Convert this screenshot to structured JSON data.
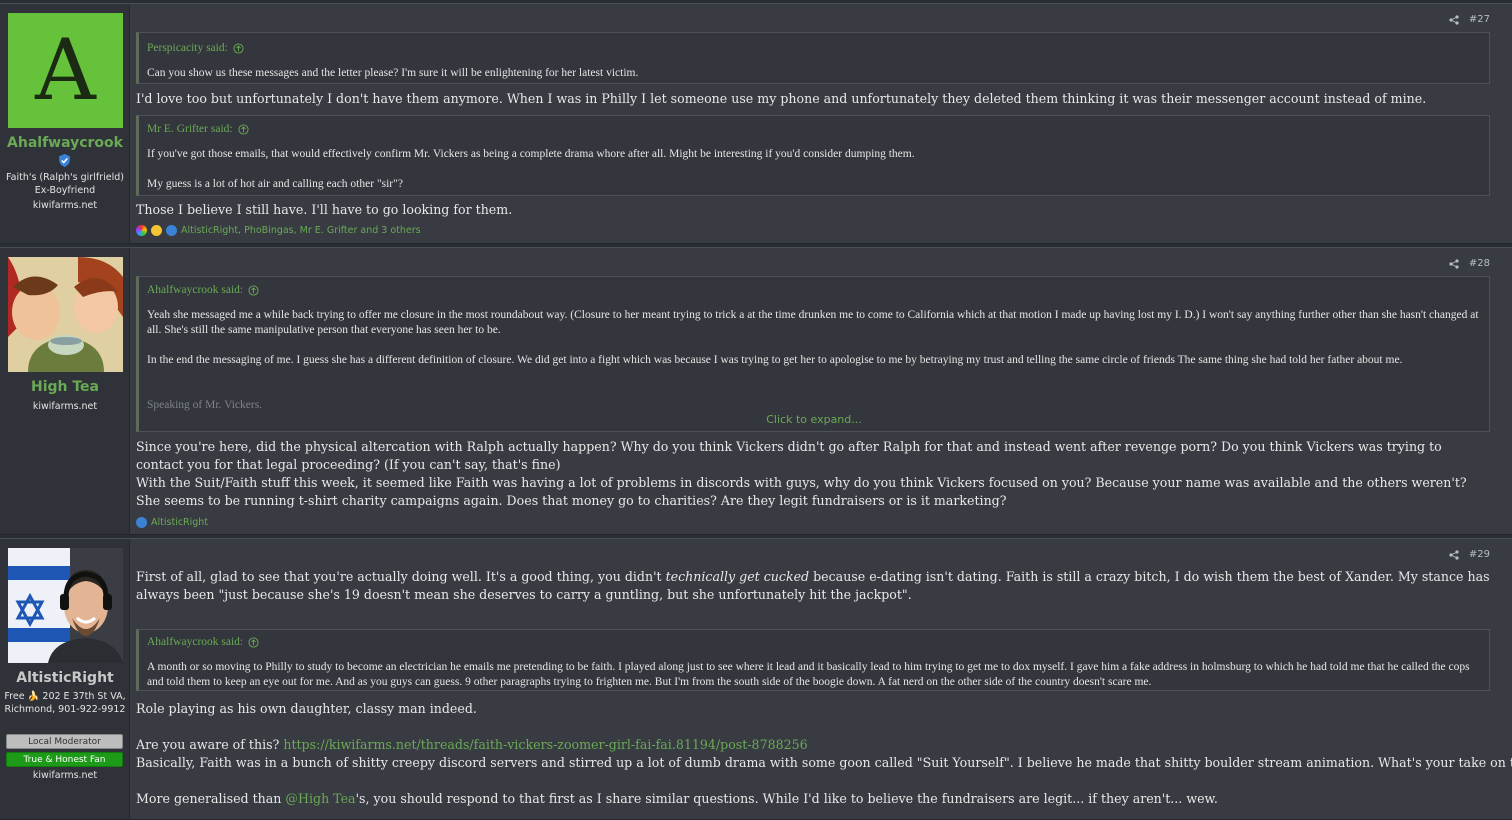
{
  "colors": {
    "accent": "#6aaa55",
    "post_bg": "#383b42",
    "quote_bg": "#33363c"
  },
  "posts": [
    {
      "number": "#27",
      "user": {
        "avatar_letter": "A",
        "name": "Ahalfwaycrook",
        "title": "Faith's (Ralph's girlfrield) Ex-Boyfriend",
        "site": "kiwifarms.net"
      },
      "quote1": {
        "author": "Perspicacity said:",
        "body": "Can you show us these messages and the letter please? I'm sure it will be enlightening for her latest victim."
      },
      "text1": "I'd love too but unfortunately I don't have them anymore. When I was in Philly I let someone use my phone and unfortunately they deleted them thinking it was their messenger account instead of mine.",
      "quote2": {
        "author": "Mr E. Grifter said:",
        "line1": "If you've got those emails, that would effectively confirm Mr. Vickers as being a complete drama whore after all. Might be interesting if you'd consider dumping them.",
        "line2": "My guess is a lot of hot air and calling each other \"sir\"?"
      },
      "text2": "Those I believe I still have. I'll have to go looking for them.",
      "reactions": "AltisticRight, PhoBingas, Mr E. Grifter and 3 others"
    },
    {
      "number": "#28",
      "user": {
        "name": "High Tea",
        "site": "kiwifarms.net"
      },
      "quote1": {
        "author": "Ahalfwaycrook said:",
        "para1": "Yeah she messaged me a while back trying to offer me closure in the most roundabout way. (Closure to her meant trying to trick a at the time drunken me to come to California which at that motion I made up having lost my I. D.) I won't say anything further other than she hasn't changed at all. She's still the same manipulative person that everyone has seen her to be.",
        "para2": "In the end the messaging of me. I guess she has a different definition of closure. We did get into a fight which was because I was trying to get her to apologise to me by betraying my trust and telling the same circle of friends The same thing she had told her father about me.",
        "faded": "Speaking of Mr. Vickers.",
        "expand": "Click to expand..."
      },
      "text1": "Since you're here, did the physical altercation with Ralph actually happen? Why do you think Vickers didn't go after Ralph for that and instead went after revenge porn? Do you think Vickers was trying to contact you for that legal proceeding? (If you can't say, that's fine)",
      "text2": "With the Suit/Faith stuff this week, it seemed like Faith was having a lot of problems in discords with guys, why do you think Vickers focused on you? Because your name was available and the others weren't?",
      "text3": "She seems to be running t-shirt charity campaigns again. Does that money go to charities? Are they legit fundraisers or is it marketing?",
      "reactions": "AltisticRight"
    },
    {
      "number": "#29",
      "user": {
        "name": "AltisticRight",
        "title": "Free 🍌 202 E 37th St VA, Richmond, 901-922-9912",
        "banner1": "Local Moderator",
        "banner2": "True & Honest Fan",
        "site": "kiwifarms.net"
      },
      "text1a": "First of all, glad to see that you're actually doing well. It's a good thing, you didn't ",
      "text1em": "technically get cucked",
      "text1b": " because e-dating isn't dating. Faith is still a crazy bitch, I do wish them the best of Xander. My stance has always been \"just because she's 19 doesn't mean she deserves to carry a guntling, but she unfortunately hit the jackpot\".",
      "quote1": {
        "author": "Ahalfwaycrook said:",
        "body": "A month or so moving to Philly to study to become an electrician he emails me pretending to be faith. I played along just to see where it lead and it basically lead to him trying to get me to dox myself. I gave him a fake address in holmsburg to which he had told me that he called the cops and told them to keep an eye out for me. And as you guys can guess. 9 other paragraphs trying to frighten me. But I'm from the south side of the boogie down. A fat nerd on the other side of the country doesn't scare me."
      },
      "text2": "Role playing as his own daughter, classy man indeed.",
      "text3a": "Are you aware of this? ",
      "text3link": "https://kiwifarms.net/threads/faith-vickers-zoomer-girl-fai-fai.81194/post-8788256",
      "text4": "Basically, Faith was in a bunch of shitty creepy discord servers and stirred up a lot of dumb drama with some goon called \"Suit Yourself\". I believe he made that shitty boulder stream animation. What's your take on this all?",
      "text5a": "More generalised than ",
      "text5mention": "@High Tea",
      "text5b": "'s, you should respond to that first as I share similar questions. While I'd like to believe the fundraisers are legit... if they aren't... wew."
    }
  ]
}
